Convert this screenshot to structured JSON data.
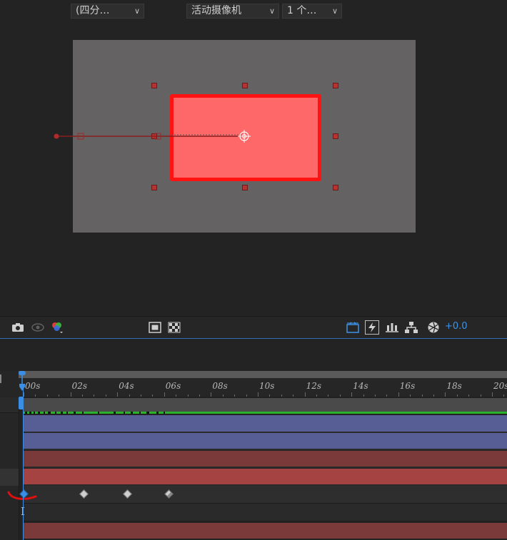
{
  "viewer": {
    "canvas_color": "#646262",
    "shape_fill": "#ff6868",
    "shape_stroke": "#ff1212"
  },
  "toolbar": {
    "resolution_dropdown": "(四分…",
    "camera_dropdown": "活动摄像机",
    "views_dropdown": "1 个…",
    "exposure_value": "+0.0",
    "icons": [
      "camera-icon",
      "show-snapshot-icon",
      "color-channels-icon",
      "region-of-interest-icon",
      "transparency-grid-icon",
      "reset-exposure-icon",
      "fast-previews-icon",
      "flowchart-icon",
      "timeline-3d-icon",
      "exposure-icon"
    ]
  },
  "timeline": {
    "ruler_labels": [
      "00s",
      "02s",
      "04s",
      "06s",
      "08s",
      "10s",
      "12s",
      "14s",
      "16s",
      "18s",
      "20s"
    ],
    "playhead_color": "#3a8ee6",
    "layer_colors": [
      "#575d95",
      "#575d95",
      "#7a3a3a",
      "#a54242",
      "#7a3a3a"
    ],
    "keyframe_count": 4,
    "cursor_glyph": "I"
  }
}
